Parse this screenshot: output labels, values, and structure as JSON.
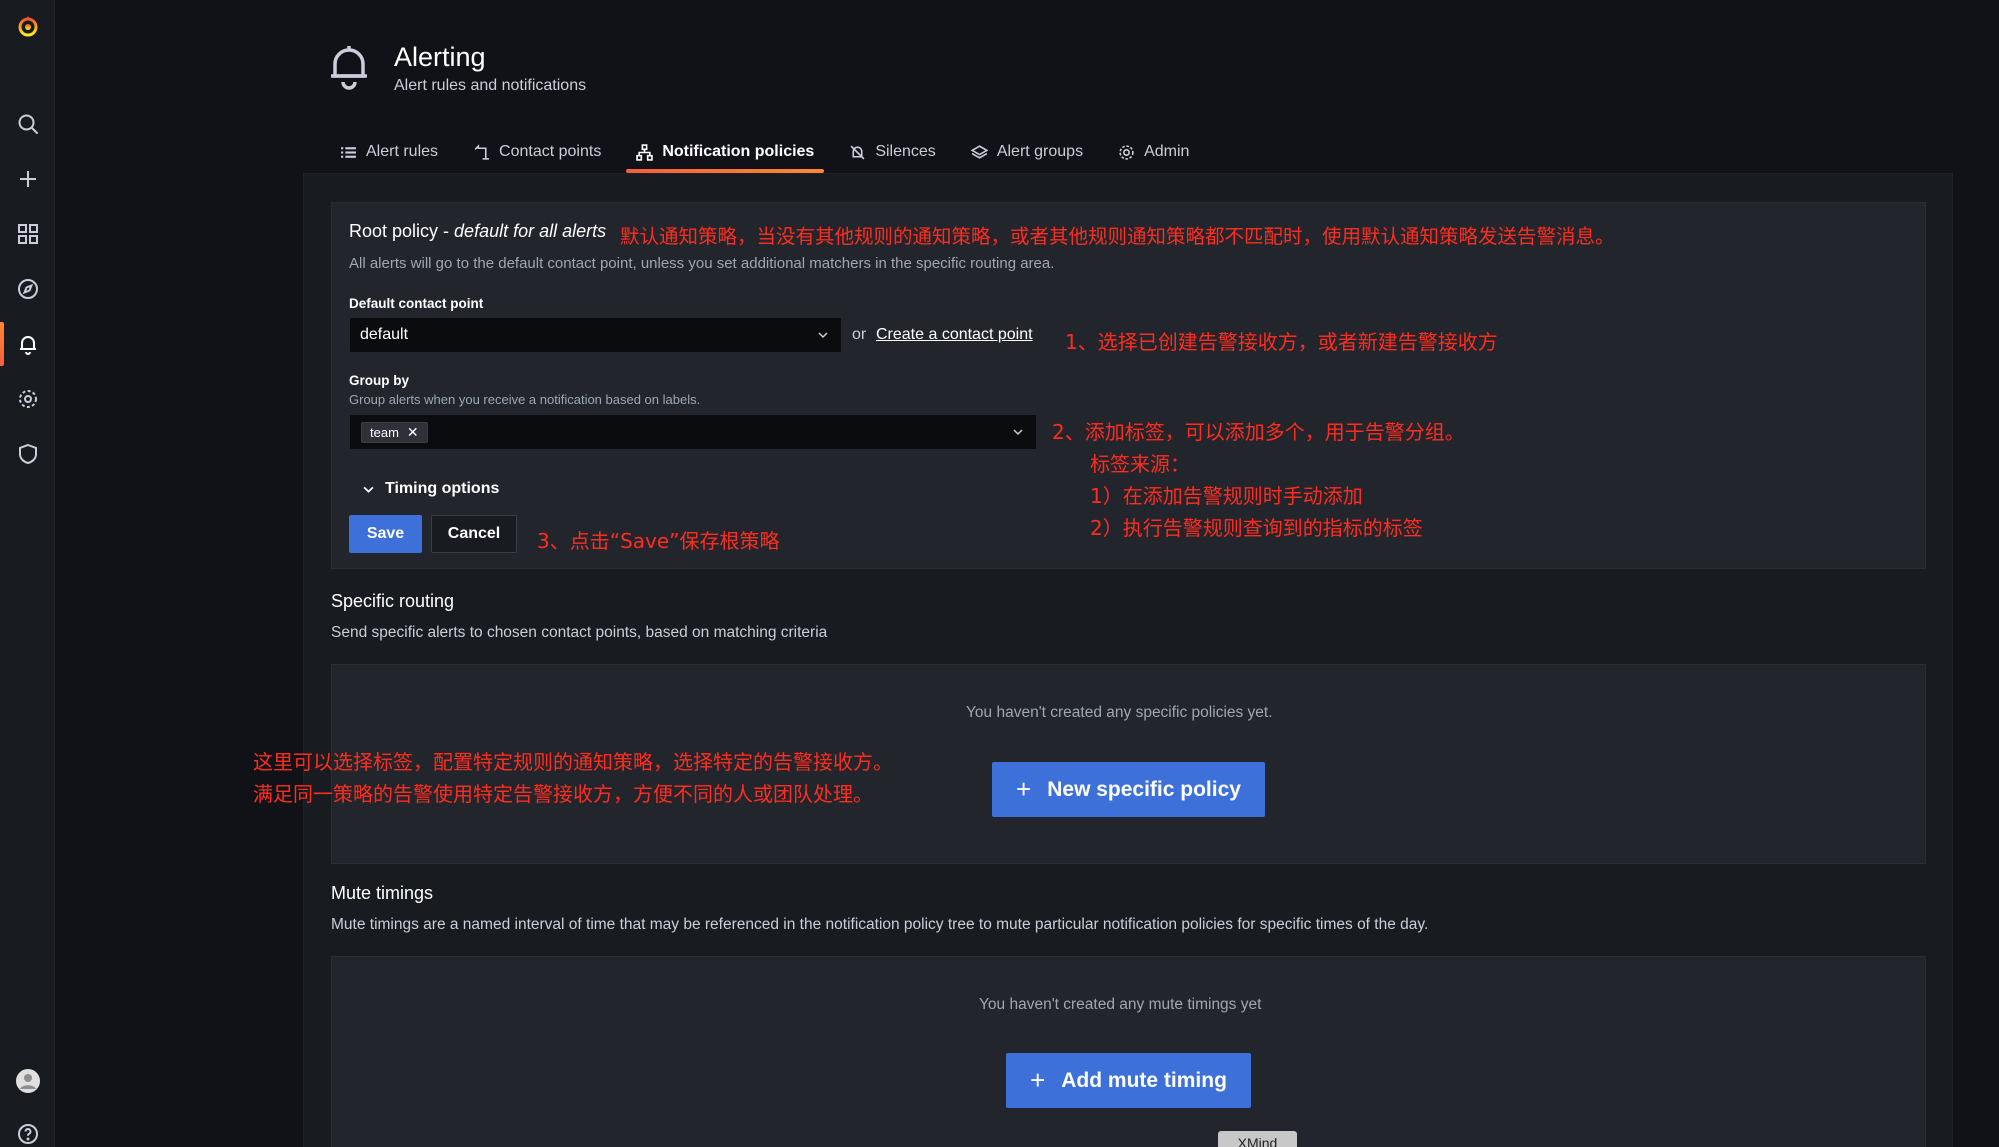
{
  "header": {
    "title": "Alerting",
    "subtitle": "Alert rules and notifications"
  },
  "tabs": [
    {
      "label": "Alert rules",
      "icon": "list-icon",
      "active": false
    },
    {
      "label": "Contact points",
      "icon": "contact-icon",
      "active": false
    },
    {
      "label": "Notification policies",
      "icon": "sitemap-icon",
      "active": true
    },
    {
      "label": "Silences",
      "icon": "bell-slash-icon",
      "active": false
    },
    {
      "label": "Alert groups",
      "icon": "layers-icon",
      "active": false
    },
    {
      "label": "Admin",
      "icon": "cog-icon",
      "active": false
    }
  ],
  "sidebar": {
    "items": [
      "grafana-logo",
      "search-icon",
      "plus-icon",
      "dashboards-icon",
      "explore-icon",
      "alerting-bell-icon",
      "configuration-cog-icon",
      "server-admin-shield-icon",
      "user-avatar",
      "help-icon"
    ],
    "active": "alerting-bell-icon"
  },
  "root_policy": {
    "title_prefix": "Root policy - ",
    "title_italic": "default for all alerts",
    "description": "All alerts will go to the default contact point, unless you set additional matchers in the specific routing area.",
    "default_contact_point_label": "Default contact point",
    "default_contact_point_value": "default",
    "or_text": "or",
    "create_contact_point_link": "Create a contact point",
    "group_by_label": "Group by",
    "group_by_description": "Group alerts when you receive a notification based on labels.",
    "group_by_tags": [
      "team"
    ],
    "timing_options_label": "Timing options",
    "save_label": "Save",
    "cancel_label": "Cancel"
  },
  "specific_routing": {
    "title": "Specific routing",
    "description": "Send specific alerts to chosen contact points, based on matching criteria",
    "empty_text": "You haven't created any specific policies yet.",
    "button_label": "New specific policy",
    "button_plus": "+"
  },
  "mute_timings": {
    "title": "Mute timings",
    "description": "Mute timings are a named interval of time that may be referenced in the notification policy tree to mute particular notification policies for specific times of the day.",
    "empty_text": "You haven't created any mute timings yet",
    "button_label": "Add mute timing",
    "button_plus": "+"
  },
  "annotations": {
    "root_policy_note": "默认通知策略，当没有其他规则的通知策略，或者其他规则通知策略都不匹配时，使用默认通知策略发送告警消息。",
    "step1": "1、选择已创建告警接收方，或者新建告警接收方",
    "step2_line1": "2、添加标签，可以添加多个，用于告警分组。",
    "step2_line2": "标签来源：",
    "step2_line3": "1）在添加告警规则时手动添加",
    "step2_line4": "2）执行告警规则查询到的指标的标签",
    "step3": "3、点击“Save”保存根策略",
    "specific_line1": "这里可以选择标签，配置特定规则的通知策略，选择特定的告警接收方。",
    "specific_line2": "满足同一策略的告警使用特定告警接收方，方便不同的人或团队处理。"
  },
  "watermark": "XMind",
  "colors": {
    "background": "#111217",
    "panel": "#22252b",
    "primary_button": "#3d71d9",
    "active_tab_gradient": [
      "#f55f3e",
      "#ff8833"
    ],
    "annotation": "#ff2d1f"
  }
}
